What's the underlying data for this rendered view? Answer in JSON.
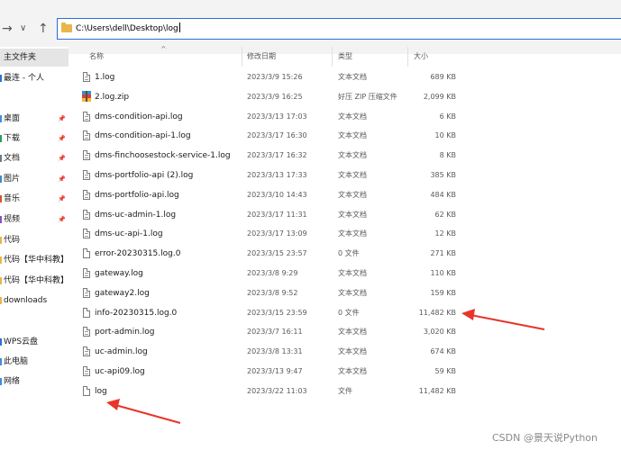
{
  "address": {
    "path": "C:\\Users\\dell\\Desktop\\log"
  },
  "nav": {
    "back": "→",
    "dropdown": "∨",
    "up": "↑"
  },
  "sidebar": {
    "items": [
      {
        "label": "主文件夹",
        "selected": true
      },
      {
        "label": "最连 - 个人",
        "color": "#2b6fd6"
      },
      {
        "label": "桌面",
        "pinned": true,
        "color": "#3c8de0"
      },
      {
        "label": "下载",
        "pinned": true,
        "color": "#2a9d5a"
      },
      {
        "label": "文档",
        "pinned": true,
        "color": "#6b7a8a"
      },
      {
        "label": "图片",
        "pinned": true,
        "color": "#3b8ec4"
      },
      {
        "label": "音乐",
        "pinned": true,
        "color": "#d2552c"
      },
      {
        "label": "视频",
        "pinned": true,
        "color": "#8a4fc4"
      },
      {
        "label": "代码",
        "color": "#e8b64c"
      },
      {
        "label": "代码【华中科教】",
        "color": "#e8b64c"
      },
      {
        "label": "代码【华中科教】",
        "color": "#e8b64c"
      },
      {
        "label": "downloads",
        "color": "#e8b64c"
      },
      {
        "label": "WPS云盘",
        "color": "#2b6fd6"
      },
      {
        "label": "此电脑",
        "color": "#3c8de0"
      },
      {
        "label": "网络",
        "color": "#3c8de0"
      }
    ]
  },
  "columns": {
    "name": "名称",
    "date": "修改日期",
    "type": "类型",
    "size": "大小"
  },
  "files": [
    {
      "name": "1.log",
      "date": "2023/3/9 15:26",
      "type": "文本文档",
      "size": "689 KB",
      "icon": "text-file"
    },
    {
      "name": "2.log.zip",
      "date": "2023/3/9 16:25",
      "type": "好压 ZIP 压缩文件",
      "size": "2,099 KB",
      "icon": "zip-file"
    },
    {
      "name": "dms-condition-api.log",
      "date": "2023/3/13 17:03",
      "type": "文本文档",
      "size": "6 KB",
      "icon": "text-file"
    },
    {
      "name": "dms-condition-api-1.log",
      "date": "2023/3/17 16:30",
      "type": "文本文档",
      "size": "10 KB",
      "icon": "text-file"
    },
    {
      "name": "dms-finchoosestock-service-1.log",
      "date": "2023/3/17 16:32",
      "type": "文本文档",
      "size": "8 KB",
      "icon": "text-file"
    },
    {
      "name": "dms-portfolio-api (2).log",
      "date": "2023/3/13 17:33",
      "type": "文本文档",
      "size": "385 KB",
      "icon": "text-file"
    },
    {
      "name": "dms-portfolio-api.log",
      "date": "2023/3/10 14:43",
      "type": "文本文档",
      "size": "484 KB",
      "icon": "text-file"
    },
    {
      "name": "dms-uc-admin-1.log",
      "date": "2023/3/17 11:31",
      "type": "文本文档",
      "size": "62 KB",
      "icon": "text-file"
    },
    {
      "name": "dms-uc-api-1.log",
      "date": "2023/3/17 13:09",
      "type": "文本文档",
      "size": "12 KB",
      "icon": "text-file"
    },
    {
      "name": "error-20230315.log.0",
      "date": "2023/3/15 23:57",
      "type": "0 文件",
      "size": "271 KB",
      "icon": "blank-file"
    },
    {
      "name": "gateway.log",
      "date": "2023/3/8 9:29",
      "type": "文本文档",
      "size": "110 KB",
      "icon": "text-file"
    },
    {
      "name": "gateway2.log",
      "date": "2023/3/8 9:52",
      "type": "文本文档",
      "size": "159 KB",
      "icon": "text-file"
    },
    {
      "name": "info-20230315.log.0",
      "date": "2023/3/15 23:59",
      "type": "0 文件",
      "size": "11,482 KB",
      "icon": "blank-file"
    },
    {
      "name": "port-admin.log",
      "date": "2023/3/7 16:11",
      "type": "文本文档",
      "size": "3,020 KB",
      "icon": "text-file"
    },
    {
      "name": "uc-admin.log",
      "date": "2023/3/8 13:31",
      "type": "文本文档",
      "size": "674 KB",
      "icon": "text-file"
    },
    {
      "name": "uc-api09.log",
      "date": "2023/3/13 9:47",
      "type": "文本文档",
      "size": "59 KB",
      "icon": "text-file"
    },
    {
      "name": "log",
      "date": "2023/3/22 11:03",
      "type": "文件",
      "size": "11,482 KB",
      "icon": "blank-file"
    }
  ],
  "annotation_color": "#e8352a",
  "watermark": "CSDN @景天说Python"
}
